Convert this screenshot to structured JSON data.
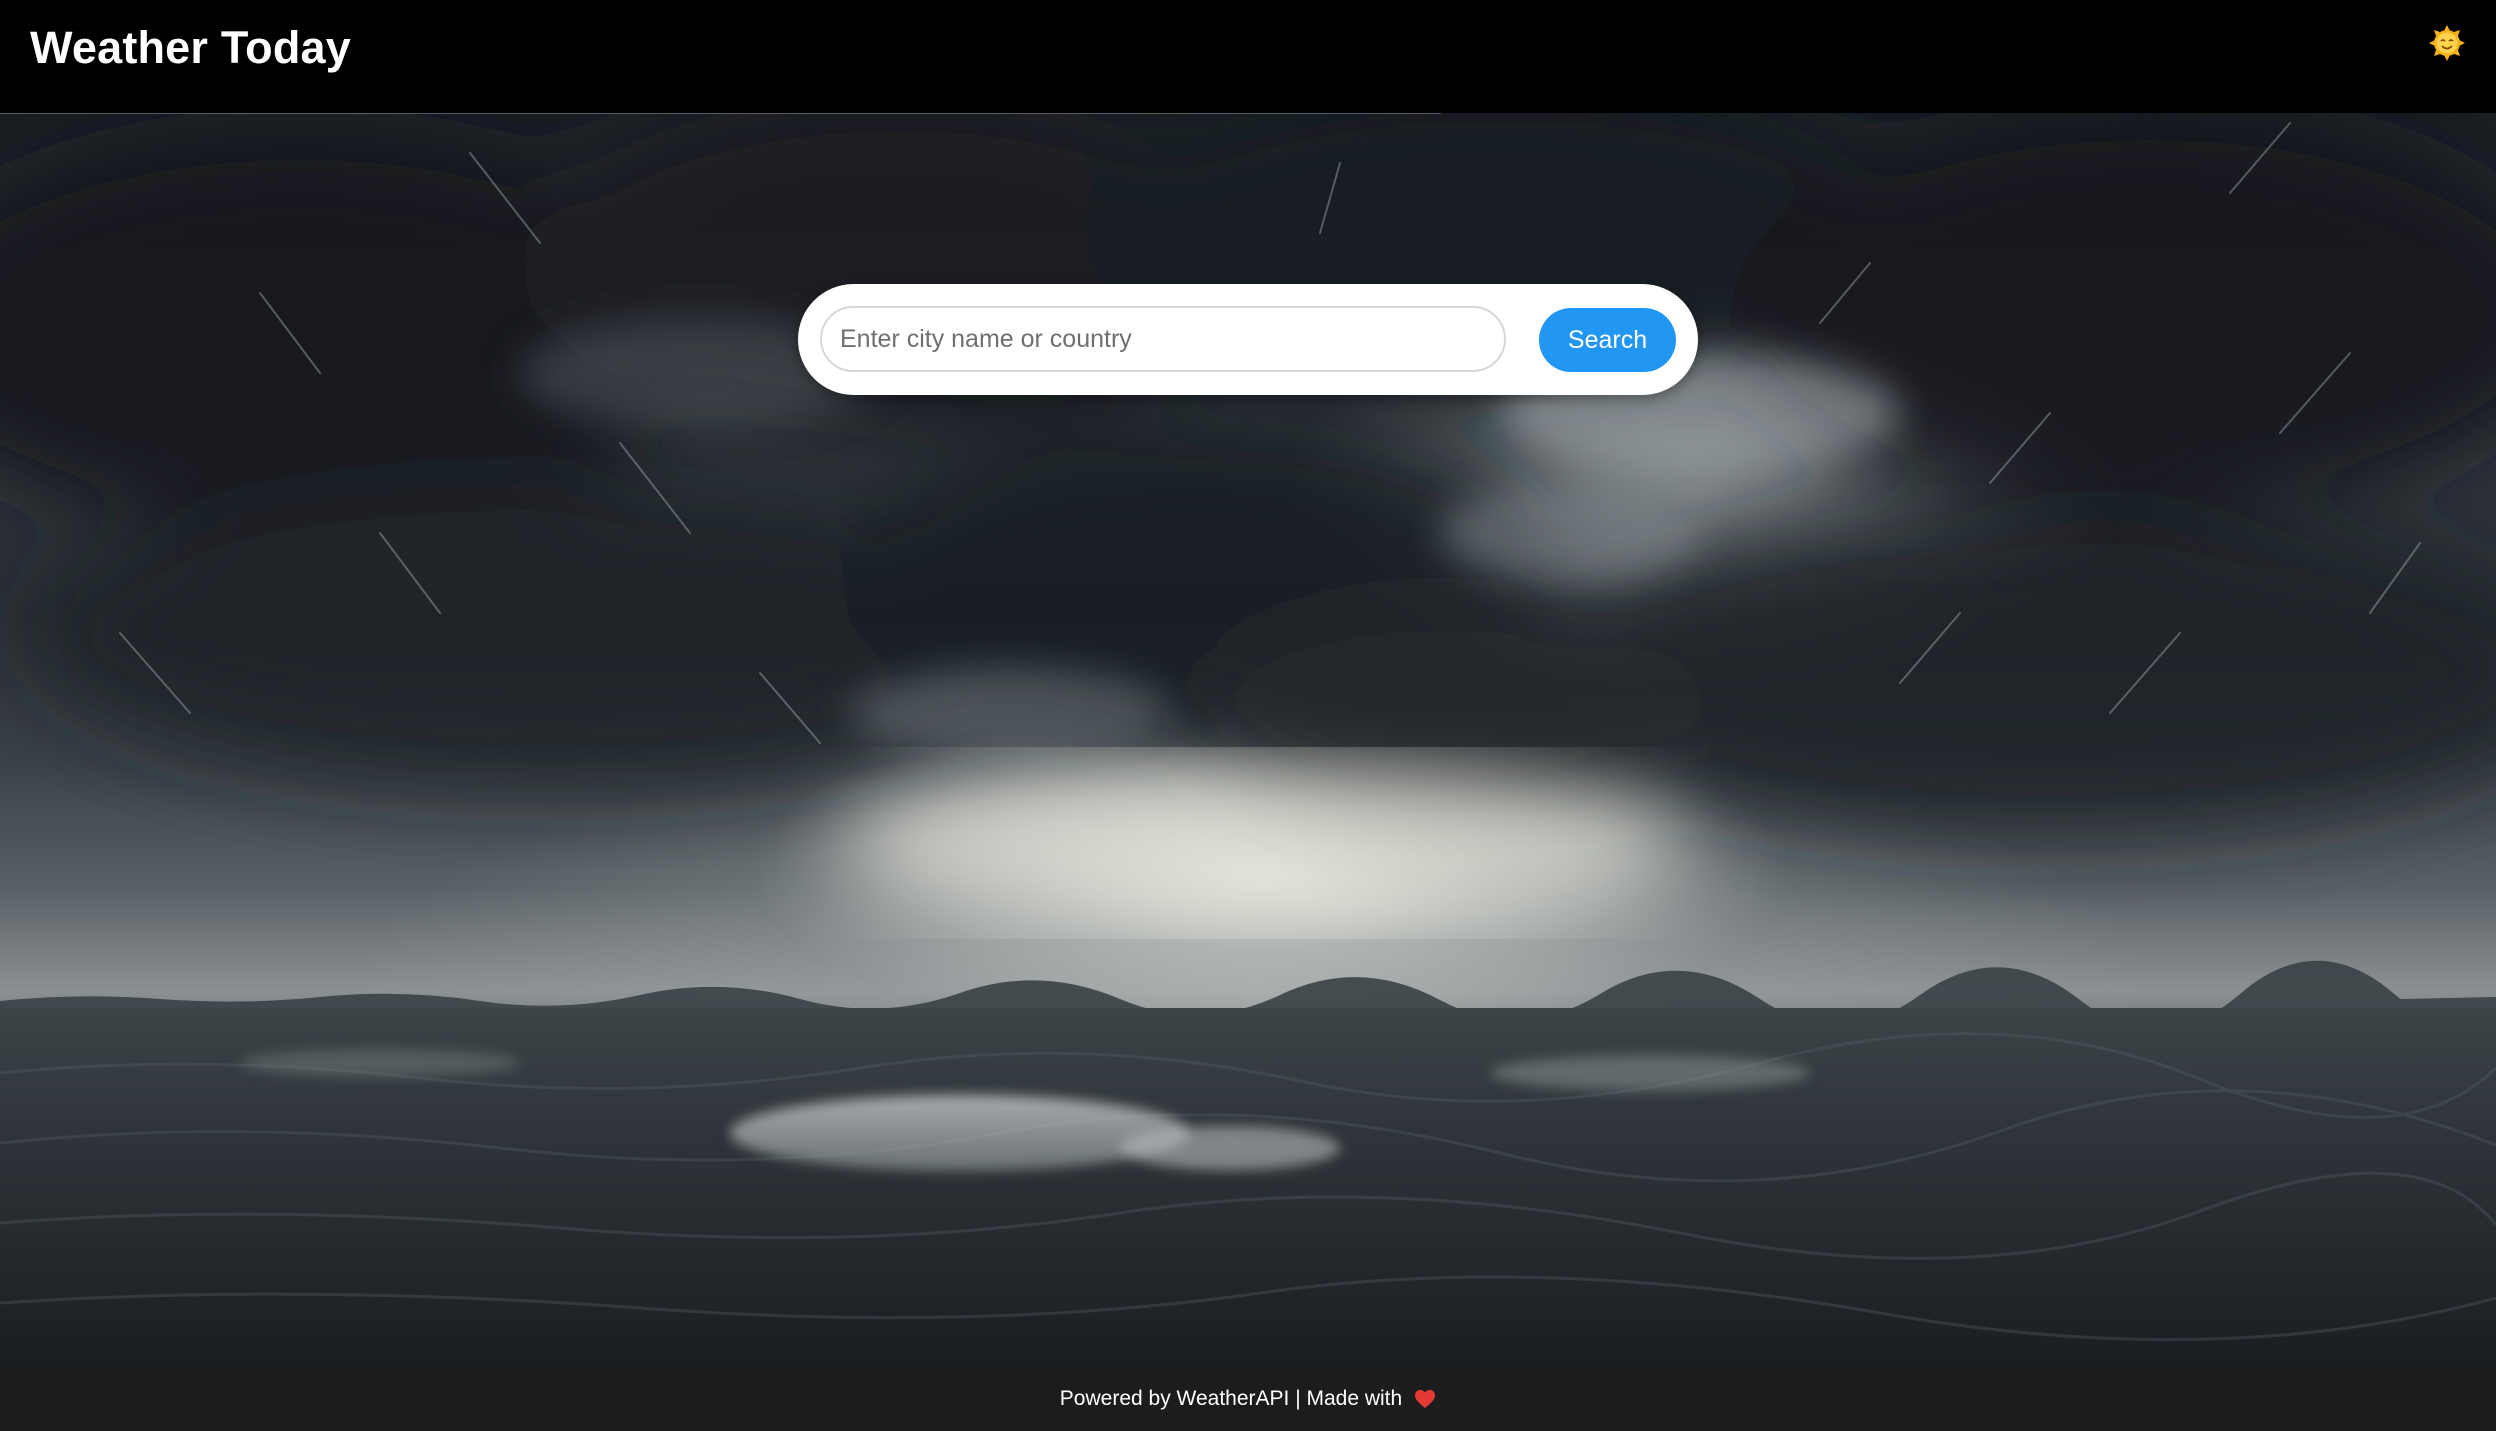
{
  "header": {
    "title": "Weather Today",
    "theme_toggle_icon": "sun-face-icon"
  },
  "search": {
    "placeholder": "Enter city name or country",
    "value": "",
    "button_label": "Search"
  },
  "background": {
    "scene": "storm-clouds-over-wet-plain"
  },
  "footer": {
    "text": "Powered by WeatherAPI | Made with",
    "icon": "heart-icon"
  },
  "colors": {
    "header_bg": "#000000",
    "accent": "#2196f3",
    "footer_bg": "#1c1c1c",
    "heart": "#e53935",
    "sun": "#f6b21c"
  }
}
